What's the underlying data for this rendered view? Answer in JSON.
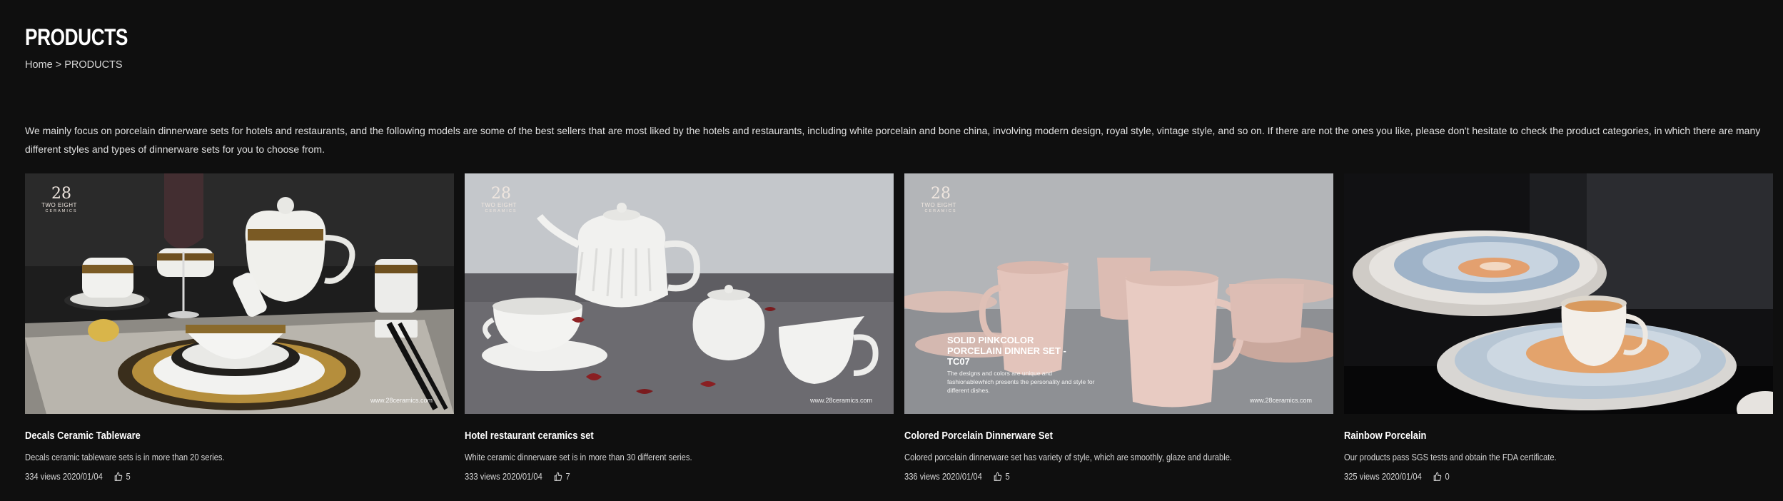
{
  "header": {
    "title": "PRODUCTS",
    "breadcrumb_home": "Home",
    "breadcrumb_sep": ">",
    "breadcrumb_current": "PRODUCTS"
  },
  "intro": "We mainly focus on porcelain dinnerware sets for hotels and restaurants, and the following models are some of the best sellers that are most liked by the hotels and restaurants, including white porcelain and bone china, involving modern design, royal style, vintage style, and so on. If there are not the ones you like, please don't hesitate to check the product categories, in which there are many different styles and types of dinnerware sets for you to choose from.",
  "logo": {
    "mark": "28",
    "name": "TWO EIGHT",
    "sub": "CERAMICS"
  },
  "watermark": "www.28ceramics.com",
  "products": [
    {
      "title": "Decals Ceramic Tableware",
      "description": "Decals ceramic tableware sets is in more than 20 series.",
      "views": "334 views",
      "date": "2020/01/04",
      "likes": "5"
    },
    {
      "title": "Hotel restaurant ceramics set",
      "description": "White ceramic dinnerware set is in more than 30 different series.",
      "views": "333 views",
      "date": "2020/01/04",
      "likes": "7"
    },
    {
      "title": "Colored Porcelain Dinnerware Set",
      "description": "Colored porcelain dinnerware set has variety of style, which are smoothly, glaze and durable.",
      "views": "336 views",
      "date": "2020/01/04",
      "likes": "5",
      "overlay_title": "SOLID PINKCOLOR PORCELAIN DINNER SET - TC07",
      "overlay_body": "The designs and colors are unique and fashionablewhich presents the personality and style for different dishes."
    },
    {
      "title": "Rainbow Porcelain",
      "description": "Our products pass SGS tests and obtain the FDA certificate.",
      "views": "325 views",
      "date": "2020/01/04",
      "likes": "0"
    }
  ],
  "icons": {
    "like": "thumbs-up-icon"
  },
  "colors": {
    "background": "#0f0f0f",
    "text": "#ffffff"
  }
}
